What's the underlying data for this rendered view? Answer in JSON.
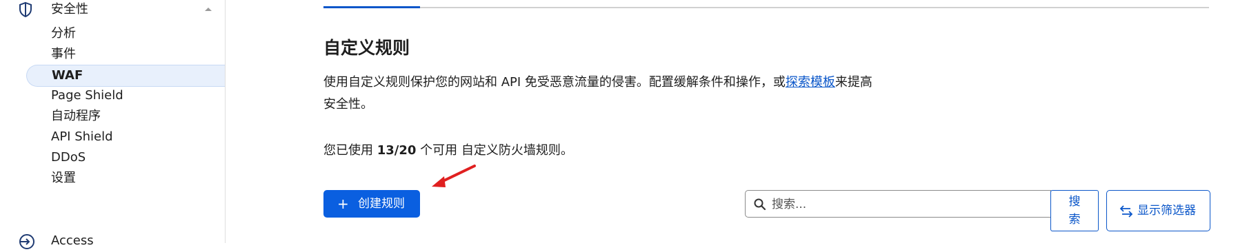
{
  "sidebar": {
    "section": {
      "label": "安全性",
      "icon": "shield-icon",
      "expanded": true
    },
    "items": [
      {
        "label": "分析"
      },
      {
        "label": "事件"
      },
      {
        "label": "WAF",
        "active": true
      },
      {
        "label": "Page Shield"
      },
      {
        "label": "自动程序"
      },
      {
        "label": "API Shield"
      },
      {
        "label": "DDoS"
      },
      {
        "label": "设置"
      }
    ],
    "next_section": {
      "label": "Access",
      "icon": "access-icon"
    }
  },
  "main": {
    "title": "自定义规则",
    "description": {
      "text": "使用自定义规则保护您的网站和 API 免受恶意流量的侵害。配置缓解条件和操作，或",
      "link": "探索模板",
      "suffix": "来提高安全性。"
    },
    "usage": {
      "prefix": "您已使用 ",
      "count": "13/20",
      "suffix": " 个可用 自定义防火墙规则。"
    },
    "create_button": {
      "icon": "plus-icon",
      "label": "创建规则"
    },
    "search": {
      "placeholder": "搜索...",
      "value": ""
    },
    "search_button": {
      "label": "搜索"
    },
    "filter_button": {
      "icon": "swap-arrows-icon",
      "label": "显示筛选器"
    }
  },
  "colors": {
    "accent": "#0a56c9",
    "button": "#0a5fe0",
    "annotation": "#e02020",
    "active_bg": "#e8f0fc"
  }
}
